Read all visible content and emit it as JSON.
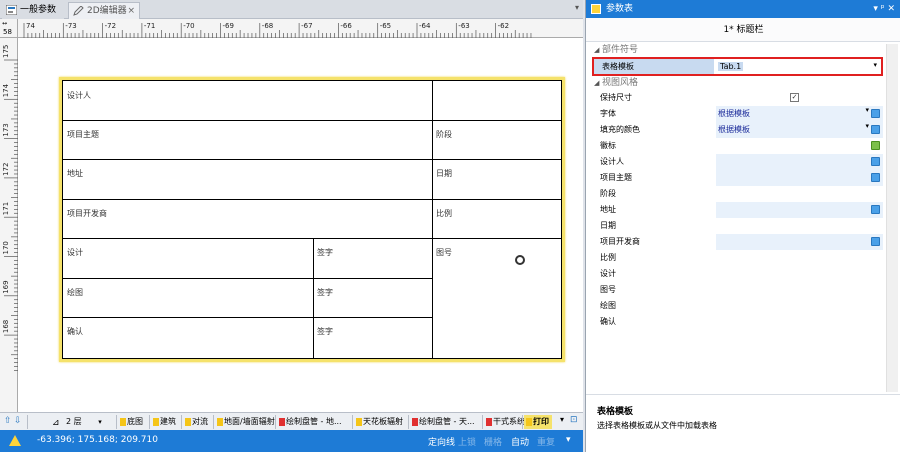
{
  "tabs": {
    "tab1": "一般参数",
    "tab2": "2D编辑器",
    "tab2_close": "×",
    "dropdown": "▾"
  },
  "ruler": {
    "corner": "58",
    "h_labels": [
      "74",
      "-73",
      "-72",
      "-71",
      "-70",
      "-69",
      "-68",
      "-67",
      "-66",
      "-65",
      "-64",
      "-63",
      "-62"
    ],
    "v_labels": [
      "175",
      "174",
      "173",
      "172",
      "171",
      "170",
      "169",
      "168"
    ]
  },
  "table_cells": {
    "designer": "设计人",
    "project_topic": "项目主题",
    "stage": "阶段",
    "address": "地址",
    "date": "日期",
    "developer": "项目开发商",
    "scale": "比例",
    "design": "设计",
    "sign1": "签字",
    "drawing_no": "图号",
    "drafting": "绘图",
    "sign2": "签字",
    "confirm": "确认",
    "sign3": "签字"
  },
  "sheets": {
    "floor": "2 层",
    "items": [
      "底图",
      "建筑",
      "对流",
      "地面/墙面辐射",
      "绘制盘管 - 地...",
      "天花板辐射",
      "绘制盘管 - 天...",
      "干式系统",
      "打印"
    ]
  },
  "status": {
    "coords": "-63.396; 175.168; 209.710",
    "modes": [
      "定向线",
      "上锁",
      "栅格",
      "自动",
      "重复"
    ],
    "dropdown": "▾"
  },
  "panel": {
    "title": "参数表",
    "buttons": "▾ ᵖ ✕",
    "subtitle": "1* 标题栏",
    "cat1": "部件符号",
    "cat2": "视图风格",
    "rows": [
      {
        "name": "表格模板",
        "value": "Tab.1"
      },
      {
        "name": "保持尺寸",
        "value": "✓"
      },
      {
        "name": "字体",
        "value": "根据模板"
      },
      {
        "name": "填充的颜色",
        "value": "根据模板"
      },
      {
        "name": "徽标",
        "value": ""
      },
      {
        "name": "设计人",
        "value": ""
      },
      {
        "name": "项目主题",
        "value": ""
      },
      {
        "name": "阶段",
        "value": ""
      },
      {
        "name": "地址",
        "value": ""
      },
      {
        "name": "日期",
        "value": ""
      },
      {
        "name": "项目开发商",
        "value": ""
      },
      {
        "name": "比例",
        "value": ""
      },
      {
        "name": "设计",
        "value": ""
      },
      {
        "name": "图号",
        "value": ""
      },
      {
        "name": "绘图",
        "value": ""
      },
      {
        "name": "确认",
        "value": ""
      }
    ],
    "desc_title": "表格模板",
    "desc_text": "选择表格模板或从文件中加载表格"
  },
  "colors": {
    "accent": "#1e7bd6",
    "highlight_border": "#e02020",
    "selection": "#f5e26b"
  }
}
